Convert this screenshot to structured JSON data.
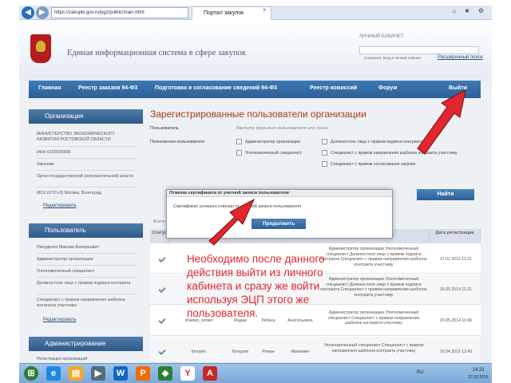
{
  "browser": {
    "url": "https://zakupki.gov.ru/pgz/public/main.html",
    "tab_title": "Портал закупок",
    "tab_close": "×",
    "window_controls": "⌂ ★ ⚙"
  },
  "site": {
    "title": "Единая информационная система в сфере закупок",
    "personal_area_label": "ЛИЧНЫЙ КАБИНЕТ",
    "remember_label": "Сохранить вход в личный кабинет",
    "personal_area_link": "Расширенный поиск",
    "nav": [
      "Главная",
      "Реестр заказов 94-Ф3",
      "Подготовка и согласование сведений 94-Ф3",
      "Реестр комиссий",
      "Форум",
      "Выйти"
    ]
  },
  "sidebar": {
    "org_header": "Организация",
    "org_name": "МИНИСТЕРСТВО ЭКОНОМИЧЕСКОГО РАЗВИТИЯ РОСТОВСКОЙ ОБЛАСТИ",
    "org_inn": "ИНН 6163035595",
    "org_role": "Заказчик",
    "org_type": "Орган государственной (исполнительной) власти",
    "org_tz": "МСК (UTC+3) Москва, Волгоград",
    "org_edit": "Редактировать",
    "user_header": "Пользователь",
    "user_name": "Пипуденко Максим Валерьевич",
    "user_roles": [
      "Администратор организации",
      "Уполномоченный специалист",
      "Должностное лицо с правом подписи контракта",
      "Специалист с правом направления шаблона контракта участнику"
    ],
    "user_edit": "Редактировать",
    "admin_header": "Администрирование",
    "admin_item": "Регистрация организаций"
  },
  "main": {
    "title": "Зарегистрированные пользователи организации",
    "user_label": "Пользователь",
    "user_placeholder": "Введите фамилию пользователя или логин",
    "perms_label": "Полномочия пользователя",
    "checkboxes": [
      "Администратор организации",
      "Уполномоченный специалист",
      "Должностное лицо с правом подписи контракта",
      "Специалист с правом направления шаблона контракта участнику",
      "Специалист с правом согласования закупки"
    ],
    "find_button": "Найти",
    "total": "Всего: 26",
    "columns": [
      "Статус",
      "Логин",
      "Фамилия",
      "Имя",
      "Отчество",
      "Полномочия",
      "Дата регистрации"
    ],
    "rows": [
      {
        "login": "",
        "lastname": "",
        "firstname": "",
        "patronymic": "",
        "perms": "Администратор организации Уполномоченный специалист Должностное лицо с правом подписи контракта Специалист с правом направления шаблона контракта участнику",
        "date": "17.01.2011 12:21"
      },
      {
        "login": "",
        "lastname": "",
        "firstname": "",
        "patronymic": "",
        "perms": "Администратор организации Уполномоченный специалист Должностное лицо с правом подписи контракта Специалист с правом направления шаблона контракта участнику",
        "date": "20.05.2014 11:31"
      },
      {
        "login": "zhadan_roman",
        "lastname": "Жадан",
        "firstname": "Ребека",
        "patronymic": "Анатольевна",
        "perms": "Администратор организации Уполномоченный специалист Специалист с правом направления шаблона контракта участнику",
        "date": "20.05.2014 11:06"
      },
      {
        "login": "ibouyko",
        "lastname": "Бочуров",
        "firstname": "Роман",
        "patronymic": "Иванович",
        "perms": "Уполномоченный специалист Специалист с правом направления шаблона контракта участнику",
        "date": "10.04.2012 12:43"
      }
    ]
  },
  "dialog": {
    "title": "Отвязка сертификата от учетной записи пользователя",
    "message": "Сертификат успешно отвязан от учетной записи пользователя",
    "button": "Продолжить"
  },
  "annotation": "Необходимо после данного действия выйти из личного кабинета и сразу же войти используя ЭЦП этого же пользователя.",
  "taskbar": {
    "lang": "RU",
    "time": "14:23",
    "date": "27.02.2016"
  },
  "colors": {
    "arrow": "#e2262e",
    "nav_blue": "#2c5f97",
    "title_red": "#a63a1e"
  }
}
